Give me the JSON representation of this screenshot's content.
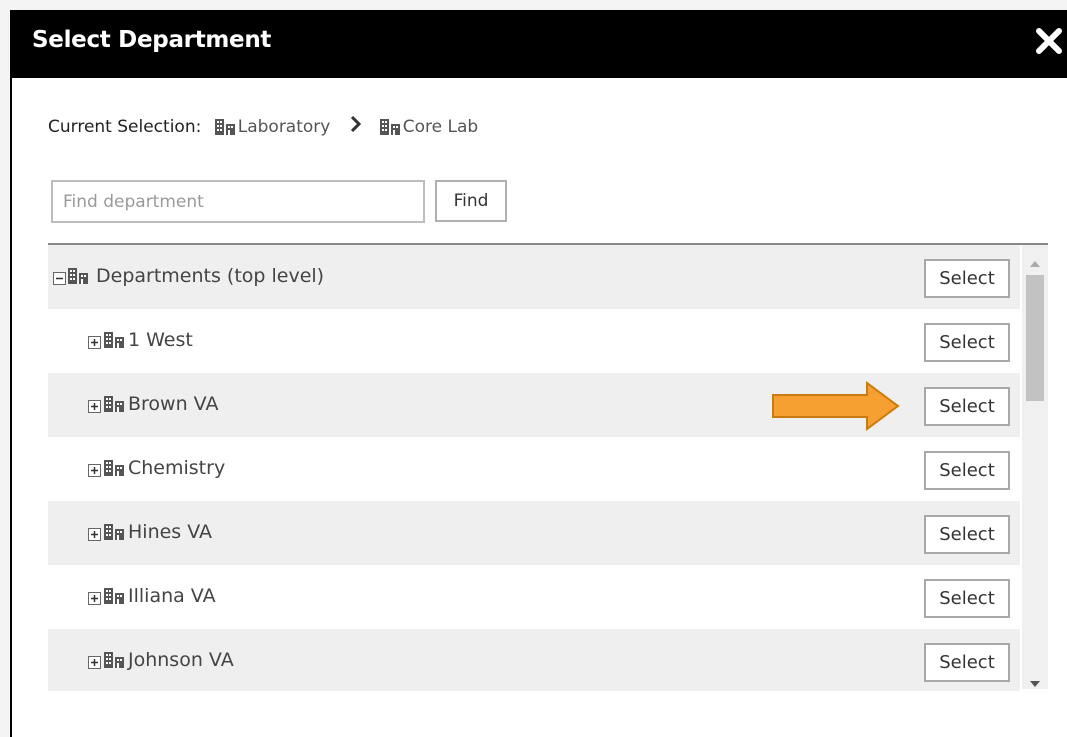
{
  "dialog": {
    "title": "Select Department",
    "close_icon": "close-icon"
  },
  "current_selection": {
    "label": "Current Selection:",
    "path": [
      "Laboratory",
      "Core Lab"
    ],
    "separator_icon": "chevron-right-icon"
  },
  "search": {
    "placeholder": "Find department",
    "value": "",
    "button_label": "Find"
  },
  "tree": {
    "root": {
      "label": "Departments (top level)",
      "expanded": true,
      "select_label": "Select"
    },
    "items": [
      {
        "label": "1 West",
        "expanded": false,
        "select_label": "Select"
      },
      {
        "label": "Brown VA",
        "expanded": false,
        "select_label": "Select"
      },
      {
        "label": "Chemistry",
        "expanded": false,
        "select_label": "Select"
      },
      {
        "label": "Hines VA",
        "expanded": false,
        "select_label": "Select"
      },
      {
        "label": "Illiana VA",
        "expanded": false,
        "select_label": "Select"
      },
      {
        "label": "Johnson VA",
        "expanded": false,
        "select_label": "Select"
      }
    ]
  },
  "annotation": {
    "icon": "arrow-right-icon",
    "color": "#f5a030"
  },
  "icons": {
    "department": "building-icon",
    "collapse": "minus-box-icon",
    "expand": "plus-box-icon"
  }
}
